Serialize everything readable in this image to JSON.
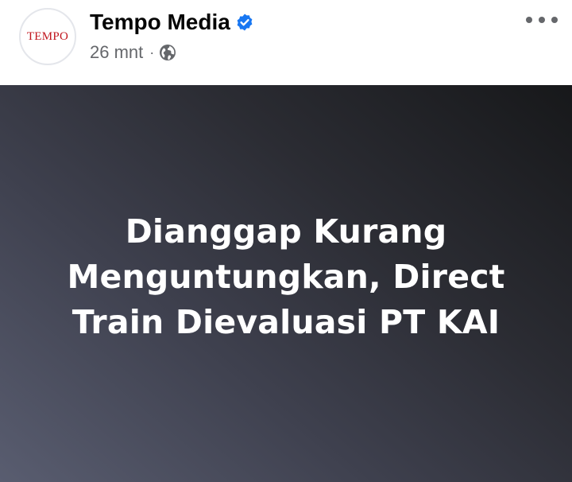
{
  "post": {
    "author": {
      "avatar_text": "TEMPO",
      "name": "Tempo Media",
      "verified": true
    },
    "time": "26 mnt",
    "separator": "·",
    "audience_icon": "globe-icon",
    "more_icon": "more-options-icon",
    "image": {
      "headline_lines": [
        "Dianggap Kurang",
        "Menguntungkan, Direct",
        "Train Dievaluasi PT KAI"
      ]
    }
  },
  "colors": {
    "verified_badge": "#1877f2",
    "logo_red": "#c0141c",
    "meta_gray": "#65676b",
    "name_black": "#050505"
  }
}
